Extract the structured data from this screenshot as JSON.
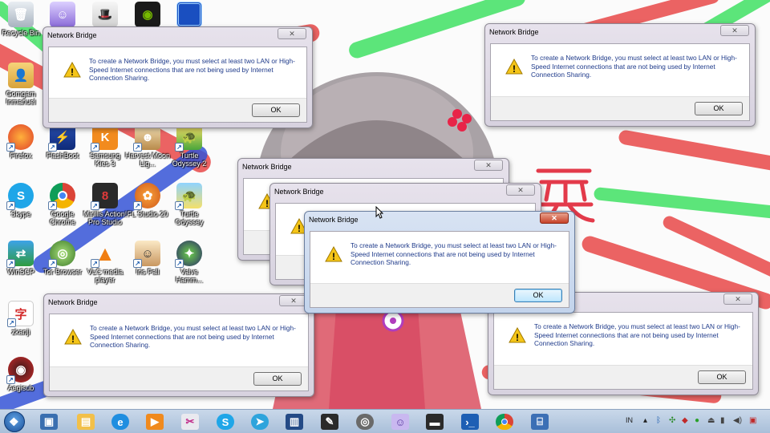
{
  "desktop": {
    "icons": [
      {
        "label": "Recycle Bin",
        "icon": "recycle-bin-icon"
      },
      {
        "label": "Gomgam Inmanuel",
        "icon": "user-folder-icon"
      },
      {
        "label": "Firefox",
        "icon": "firefox-icon"
      },
      {
        "label": "Skype",
        "icon": "skype-icon"
      },
      {
        "label": "WinSCP",
        "icon": "winscp-icon"
      },
      {
        "label": "Tor Browser",
        "icon": "tor-browser-icon"
      },
      {
        "label": "FlashBoot",
        "icon": "flashboot-icon"
      },
      {
        "label": "Google Chrome",
        "icon": "chrome-icon"
      },
      {
        "label": "Samsung Kies 3",
        "icon": "samsung-kies-icon"
      },
      {
        "label": "Mirillis Action! Pro Studio",
        "icon": "studio-icon"
      },
      {
        "label": "VLC media player",
        "icon": "vlc-icon"
      },
      {
        "label": "Harvest Moon Lig...",
        "icon": "harvest-moon-icon"
      },
      {
        "label": "FL Studio 20",
        "icon": "fl-studio-icon"
      },
      {
        "label": "Iris Fall",
        "icon": "iris-fall-icon"
      },
      {
        "label": "Turtle Odyssey 2",
        "icon": "turtle-odyssey-2-icon"
      },
      {
        "label": "Turtle Odyssey",
        "icon": "turtle-odyssey-icon"
      },
      {
        "label": "Valve Hamm...",
        "icon": "valve-hammer-icon"
      },
      {
        "label": "zkanji",
        "icon": "zkanji-icon"
      },
      {
        "label": "Aegisub",
        "icon": "aegisub-icon"
      }
    ]
  },
  "dialog": {
    "title": "Network Bridge",
    "message": "To create a Network Bridge, you must select at least two LAN or High-Speed Internet connections that are not being used by Internet Connection Sharing.",
    "ok_label": "OK",
    "close_glyph": "✕"
  },
  "taskbar": {
    "start_glyph": "❖",
    "pinned": [
      {
        "icon": "windows-explorer-icon"
      },
      {
        "icon": "file-manager-icon"
      },
      {
        "icon": "internet-explorer-icon"
      },
      {
        "icon": "media-player-icon"
      },
      {
        "icon": "snipping-tool-icon"
      },
      {
        "icon": "skype-icon"
      },
      {
        "icon": "telegram-icon"
      },
      {
        "icon": "remote-desktop-icon"
      },
      {
        "icon": "pen-tablet-icon"
      },
      {
        "icon": "gimp-icon"
      },
      {
        "icon": "anime-app-icon"
      },
      {
        "icon": "book-app-icon"
      },
      {
        "icon": "powershell-icon"
      },
      {
        "icon": "chrome-icon"
      },
      {
        "icon": "network-icon"
      }
    ],
    "tray": {
      "language": "IN"
    }
  },
  "colors": {
    "message_text": "#1e3a8a",
    "taskbar": "#b9cbe2",
    "active_close": "#c7432a"
  }
}
